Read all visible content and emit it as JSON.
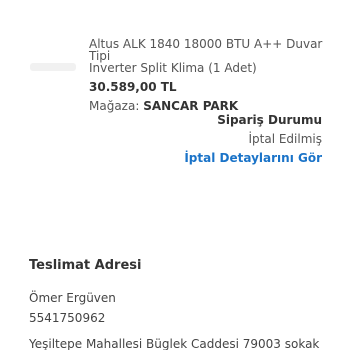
{
  "product": {
    "title_line1": "Altus ALK 1840 18000 BTU A++ Duvar Tipi",
    "title_line2": "Inverter Split Klima (1 Adet)",
    "price": "30.589,00 TL",
    "store_label": "Mağaza:",
    "store_name": "SANCAR PARK"
  },
  "order_status": {
    "title": "Sipariş Durumu",
    "value": "İptal Edilmiş",
    "details_link": "İptal Detaylarını Gör"
  },
  "delivery": {
    "heading": "Teslimat Adresi",
    "name": "Ömer Ergüven",
    "phone": "5541750962",
    "address": "Yeşiltepe Mahallesi Büglek Caddesi 79003 sokak"
  },
  "colors": {
    "link": "#1a73c8",
    "text": "#333333"
  }
}
